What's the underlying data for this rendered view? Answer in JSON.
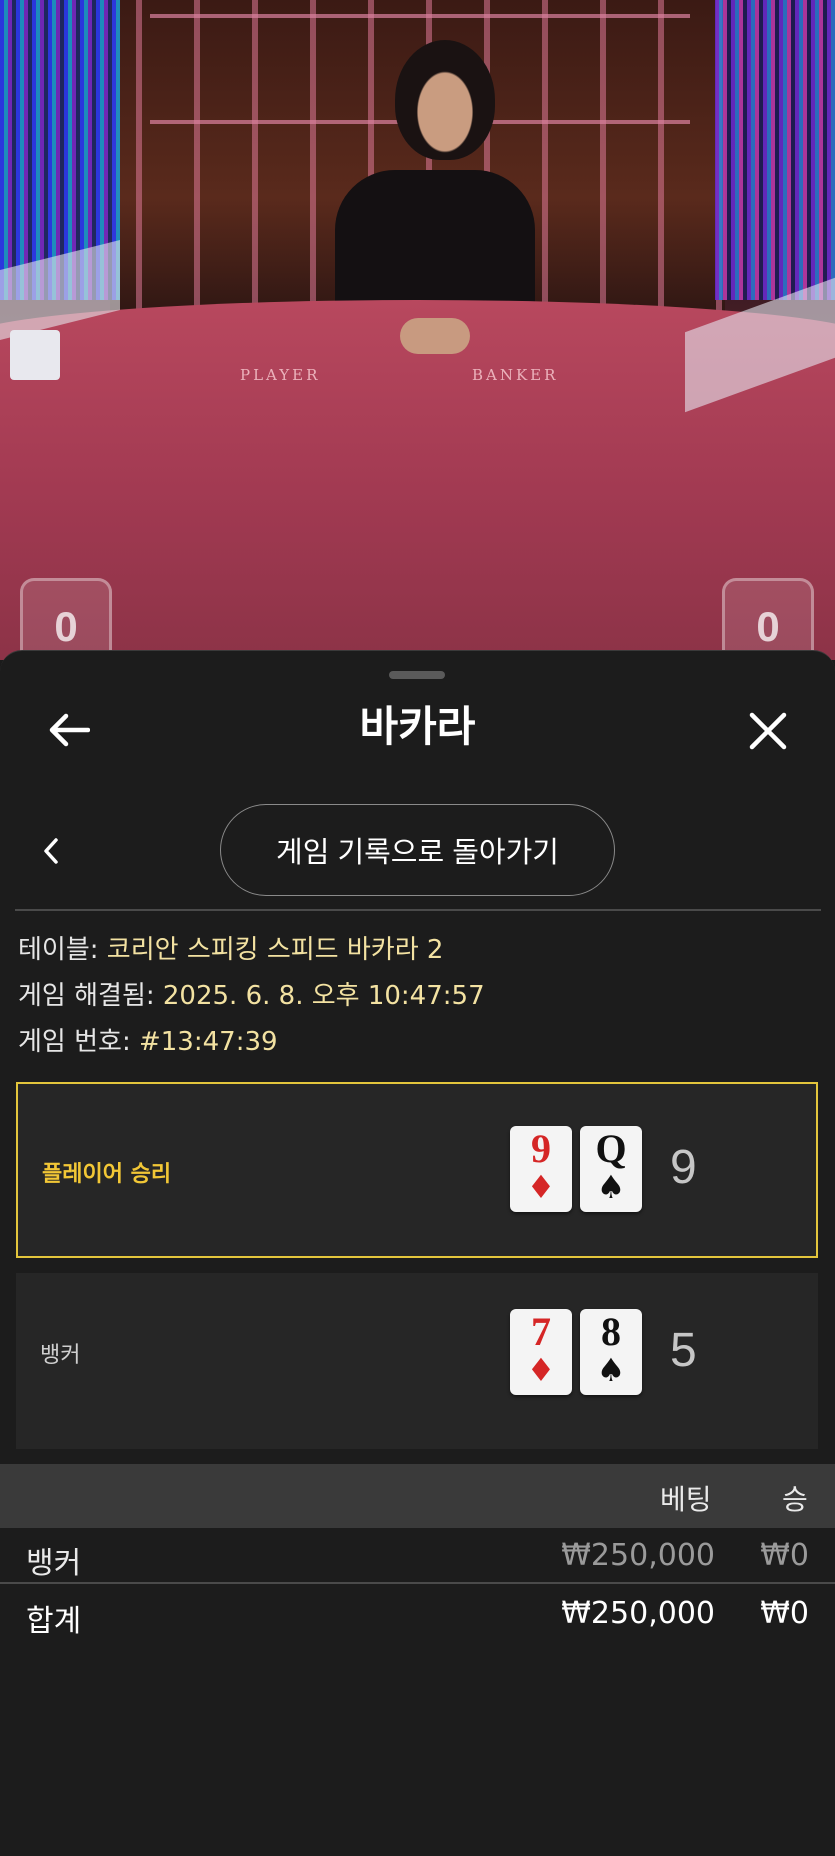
{
  "video": {
    "player_label": "PLAYER",
    "banker_label": "BANKER",
    "player_score": "0",
    "banker_score": "0"
  },
  "header": {
    "title": "바카라",
    "back_icon": "arrow-left-icon",
    "close_icon": "close-icon"
  },
  "nav": {
    "chevron_icon": "chevron-left-icon",
    "history_button": "게임 기록으로 돌아가기"
  },
  "info": {
    "table_label": "테이블: ",
    "table_value": "코리안 스피킹 스피드 바카라 2",
    "resolved_label": "게임 해결됨: ",
    "resolved_value": "2025. 6. 8. 오후 10:47:57",
    "number_label": "게임 번호: ",
    "number_value": "#13:47:39"
  },
  "result": {
    "player": {
      "label": "플레이어 승리",
      "cards": [
        {
          "rank": "9",
          "suit": "♦",
          "color": "red"
        },
        {
          "rank": "Q",
          "suit": "♠",
          "color": "black"
        }
      ],
      "score": "9",
      "highlight_color": "#e3c53c"
    },
    "banker": {
      "label": "뱅커",
      "cards": [
        {
          "rank": "7",
          "suit": "♦",
          "color": "red"
        },
        {
          "rank": "8",
          "suit": "♠",
          "color": "black"
        }
      ],
      "score": "5"
    }
  },
  "bets": {
    "headers": {
      "bet": "베팅",
      "win": "승"
    },
    "rows": [
      {
        "name": "뱅커",
        "bet": "₩250,000",
        "win": "₩0"
      }
    ],
    "total": {
      "name": "합계",
      "bet": "₩250,000",
      "win": "₩0"
    }
  }
}
